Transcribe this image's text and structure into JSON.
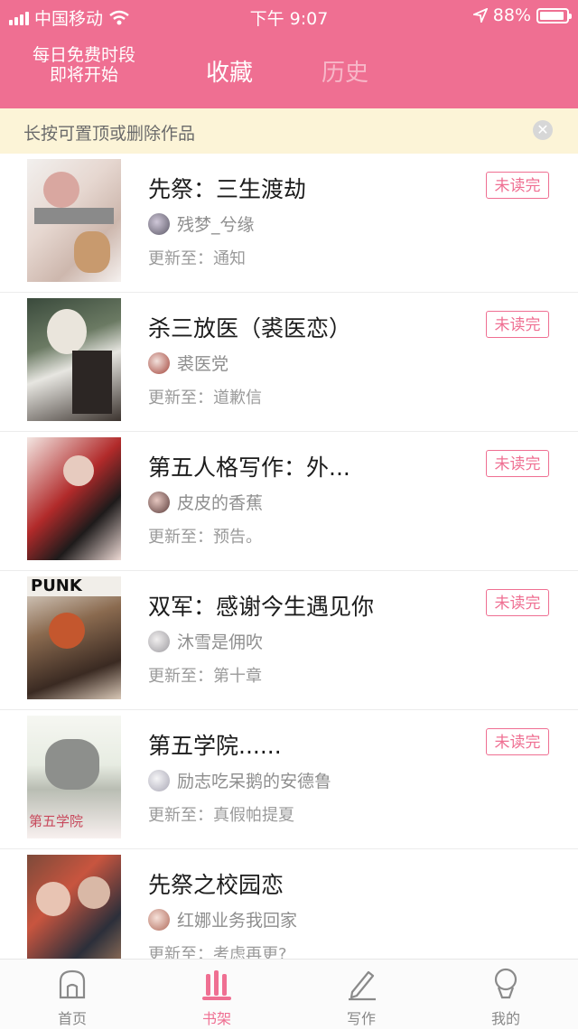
{
  "status_bar": {
    "carrier": "中国移动",
    "time": "下午 9:07",
    "battery": "88%",
    "battery_level": 0.88
  },
  "header": {
    "promo_line1": "每日免费时段",
    "promo_line2": "即将开始",
    "tabs": [
      {
        "label": "收藏",
        "active": true
      },
      {
        "label": "历史",
        "active": false
      }
    ]
  },
  "notice": {
    "text": "长按可置顶或删除作品",
    "close_icon": "close-circle-icon"
  },
  "colors": {
    "brand": "#ef6f92",
    "notice_bg": "#fcf4d7"
  },
  "books": [
    {
      "title": "先祭：三生渡劫",
      "author": "残梦_兮缘",
      "update": "更新至：通知",
      "badge": "未读完"
    },
    {
      "title": "杀三放医（裘医恋）",
      "author": "裘医党",
      "update": "更新至：道歉信",
      "badge": "未读完"
    },
    {
      "title": "第五人格写作：外...",
      "author": "皮皮的香蕉",
      "update": "更新至：预告。",
      "badge": "未读完"
    },
    {
      "title": "双军：感谢今生遇见你",
      "author": "沐雪是佣吹",
      "update": "更新至：第十章",
      "badge": "未读完"
    },
    {
      "title": "第五学院......",
      "author": "励志吃呆鹅的安德鲁",
      "update": "更新至：真假帕提夏",
      "badge": "未读完"
    },
    {
      "title": "先祭之校园恋",
      "author": "红娜业务我回家",
      "update": "更新至：考虑再更?",
      "badge": ""
    }
  ],
  "tabbar": [
    {
      "label": "首页",
      "icon": "home-icon"
    },
    {
      "label": "书架",
      "icon": "bookshelf-icon",
      "active": true
    },
    {
      "label": "写作",
      "icon": "pencil-icon"
    },
    {
      "label": "我的",
      "icon": "profile-icon"
    }
  ]
}
